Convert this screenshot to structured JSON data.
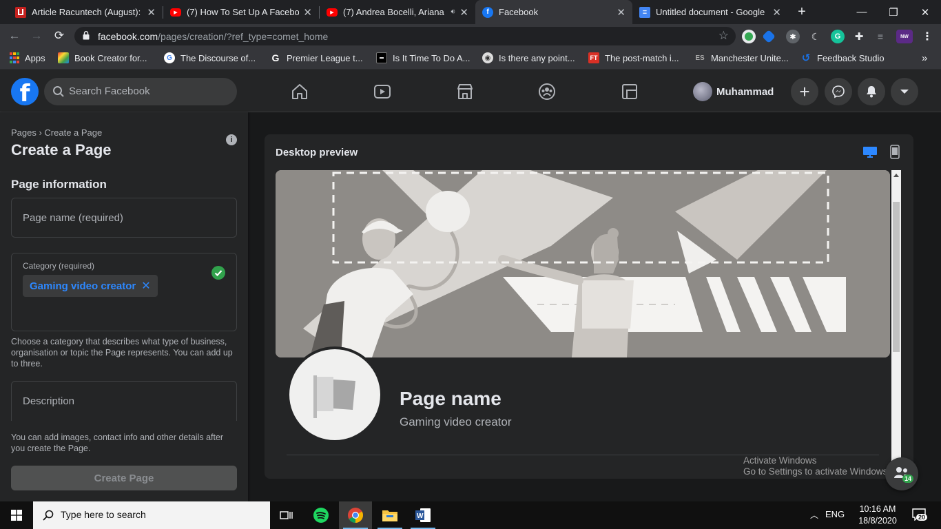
{
  "browser": {
    "tabs": [
      {
        "title": "Article Racuntech (August): ",
        "favicon_color": "#c5221f",
        "favicon_glyph": ""
      },
      {
        "title": "(7) How To Set Up A Facebo",
        "favicon_color": "#ff0000",
        "favicon_glyph": "▶"
      },
      {
        "title": "(7) Andrea Bocelli, Ariana",
        "favicon_color": "#ff0000",
        "favicon_glyph": "▶"
      },
      {
        "title": "Facebook",
        "favicon_color": "#1877f2",
        "favicon_glyph": "f"
      },
      {
        "title": "Untitled document - Google",
        "favicon_color": "#4285f4",
        "favicon_glyph": "≡"
      }
    ],
    "url_domain": "facebook.com",
    "url_path": "/pages/creation/?ref_type=comet_home",
    "bookmarks": [
      {
        "label": "Apps",
        "color": "#ea4335"
      },
      {
        "label": "Book Creator for...",
        "color": "#8e24aa"
      },
      {
        "label": "The Discourse of...",
        "color": "#ffffff"
      },
      {
        "label": "Premier League t...",
        "color": "#1a73e8"
      },
      {
        "label": "Is It Time To Do A...",
        "color": "#000000"
      },
      {
        "label": "Is there any point...",
        "color": "#ffffff"
      },
      {
        "label": "The post-match i...",
        "color": "#d93025"
      },
      {
        "label": "Manchester Unite...",
        "color": "#444444"
      },
      {
        "label": "Feedback Studio",
        "color": "#1a73e8"
      }
    ],
    "more_bookmarks": "»"
  },
  "facebook": {
    "logo": "f",
    "search_placeholder": "Search Facebook",
    "profile_name": "Muhammad",
    "accent": "#1877f2"
  },
  "left_panel": {
    "breadcrumb": "Pages › Create a Page",
    "title": "Create a Page",
    "info_glyph": "i",
    "section_title": "Page information",
    "page_name_placeholder": "Page name (required)",
    "category_label": "Category (required)",
    "category_chip": "Gaming video creator",
    "category_help": "Choose a category that describes what type of business, organisation or topic the Page represents. You can add up to three.",
    "description_placeholder": "Description",
    "bottom_help": "You can add images, contact info and other details after you create the Page.",
    "create_button": "Create Page"
  },
  "preview": {
    "title": "Desktop preview",
    "page_name": "Page name",
    "category": "Gaming video creator"
  },
  "overlay": {
    "activate_line1": "Activate Windows",
    "activate_line2": "Go to Settings to activate Windows.",
    "chat_badge": "14"
  },
  "taskbar": {
    "search_placeholder": "Type here to search",
    "language": "ENG",
    "time": "10:16 AM",
    "date": "18/8/2020",
    "notifications": "20"
  }
}
